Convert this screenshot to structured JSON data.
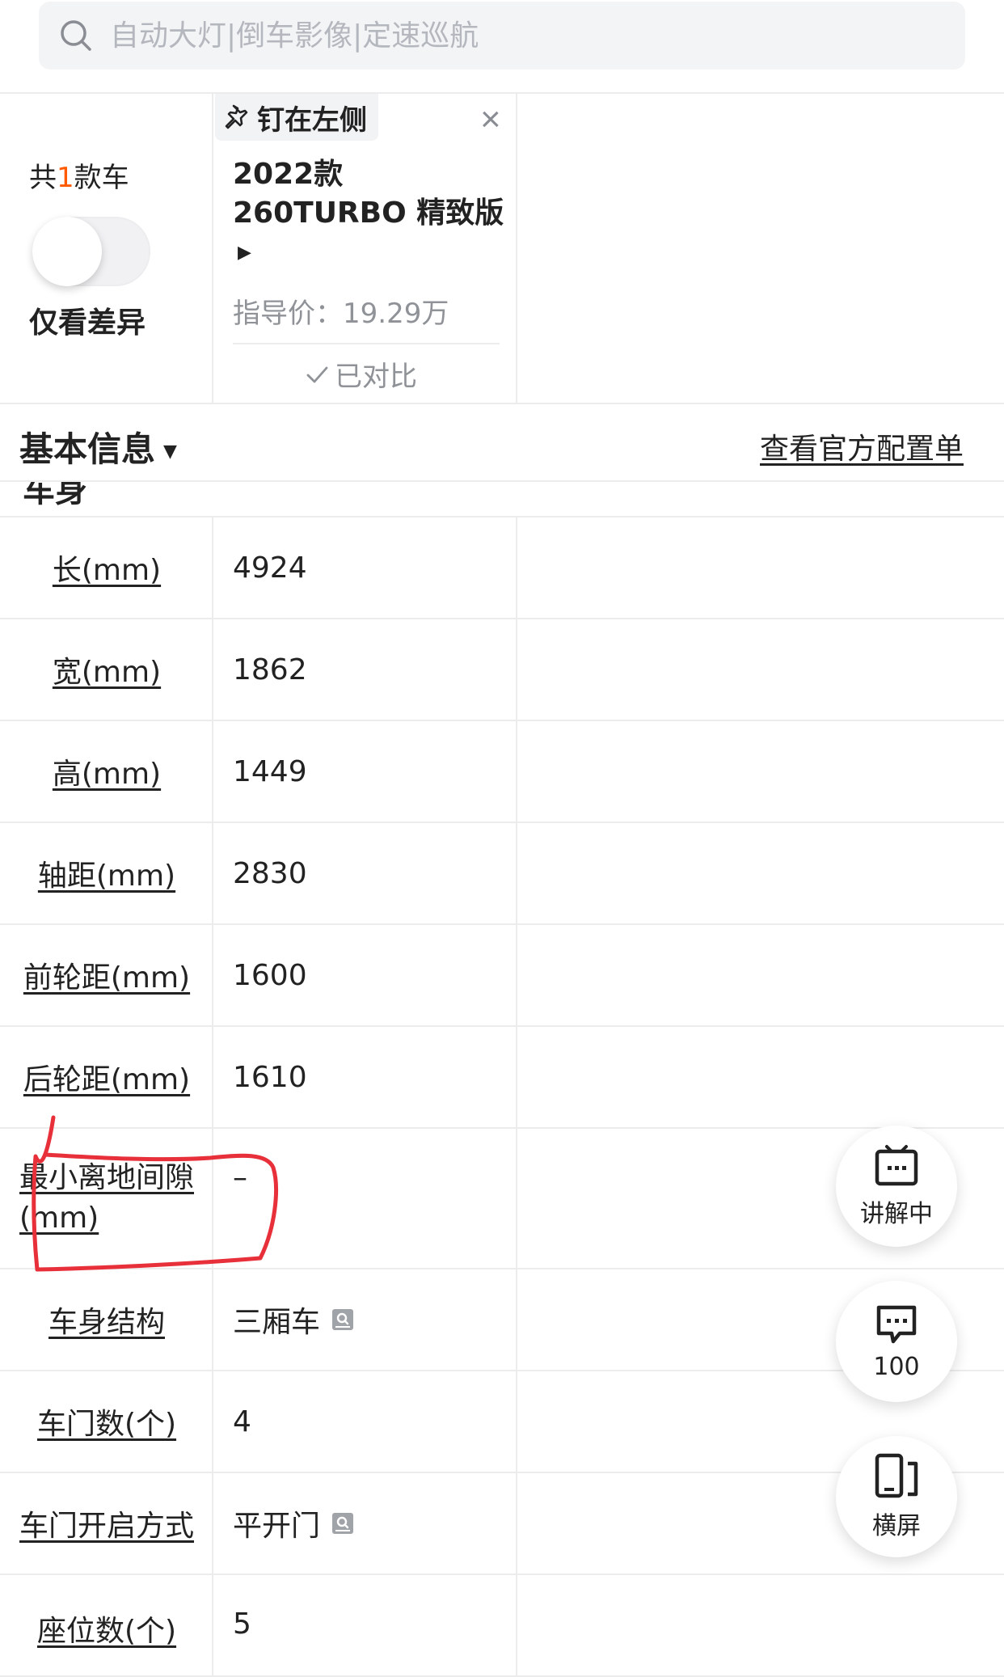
{
  "search": {
    "placeholder": "自动大灯|倒车影像|定速巡航"
  },
  "header": {
    "count_prefix": "共",
    "count_num": "1",
    "count_suffix": "款车",
    "diff_toggle_label": "仅看差异",
    "pin_label": "钉在左侧",
    "close_symbol": "×",
    "car_name": "2022款 260TURBO 精致版",
    "price": "指导价：19.29万",
    "compared_label": "已对比"
  },
  "section": {
    "title": "基本信息",
    "official_link": "查看官方配置单",
    "group_title": "车身"
  },
  "rows": [
    {
      "label": "长(mm)",
      "value": "4924"
    },
    {
      "label": "宽(mm)",
      "value": "1862"
    },
    {
      "label": "高(mm)",
      "value": "1449"
    },
    {
      "label": "轴距(mm)",
      "value": "2830"
    },
    {
      "label": "前轮距(mm)",
      "value": "1600"
    },
    {
      "label": "后轮距(mm)",
      "value": "1610"
    },
    {
      "label": "最小离地间隙(mm)",
      "value": "–"
    },
    {
      "label": "车身结构",
      "value": "三厢车"
    },
    {
      "label": "车门数(个)",
      "value": "4"
    },
    {
      "label": "车门开启方式",
      "value": "平开门"
    },
    {
      "label": "座位数(个)",
      "value": "5"
    }
  ],
  "fabs": {
    "explain": "讲解中",
    "comments": "100",
    "landscape": "横屏"
  },
  "colors": {
    "accent": "#ff5a00",
    "annotation": "#e8303a"
  }
}
